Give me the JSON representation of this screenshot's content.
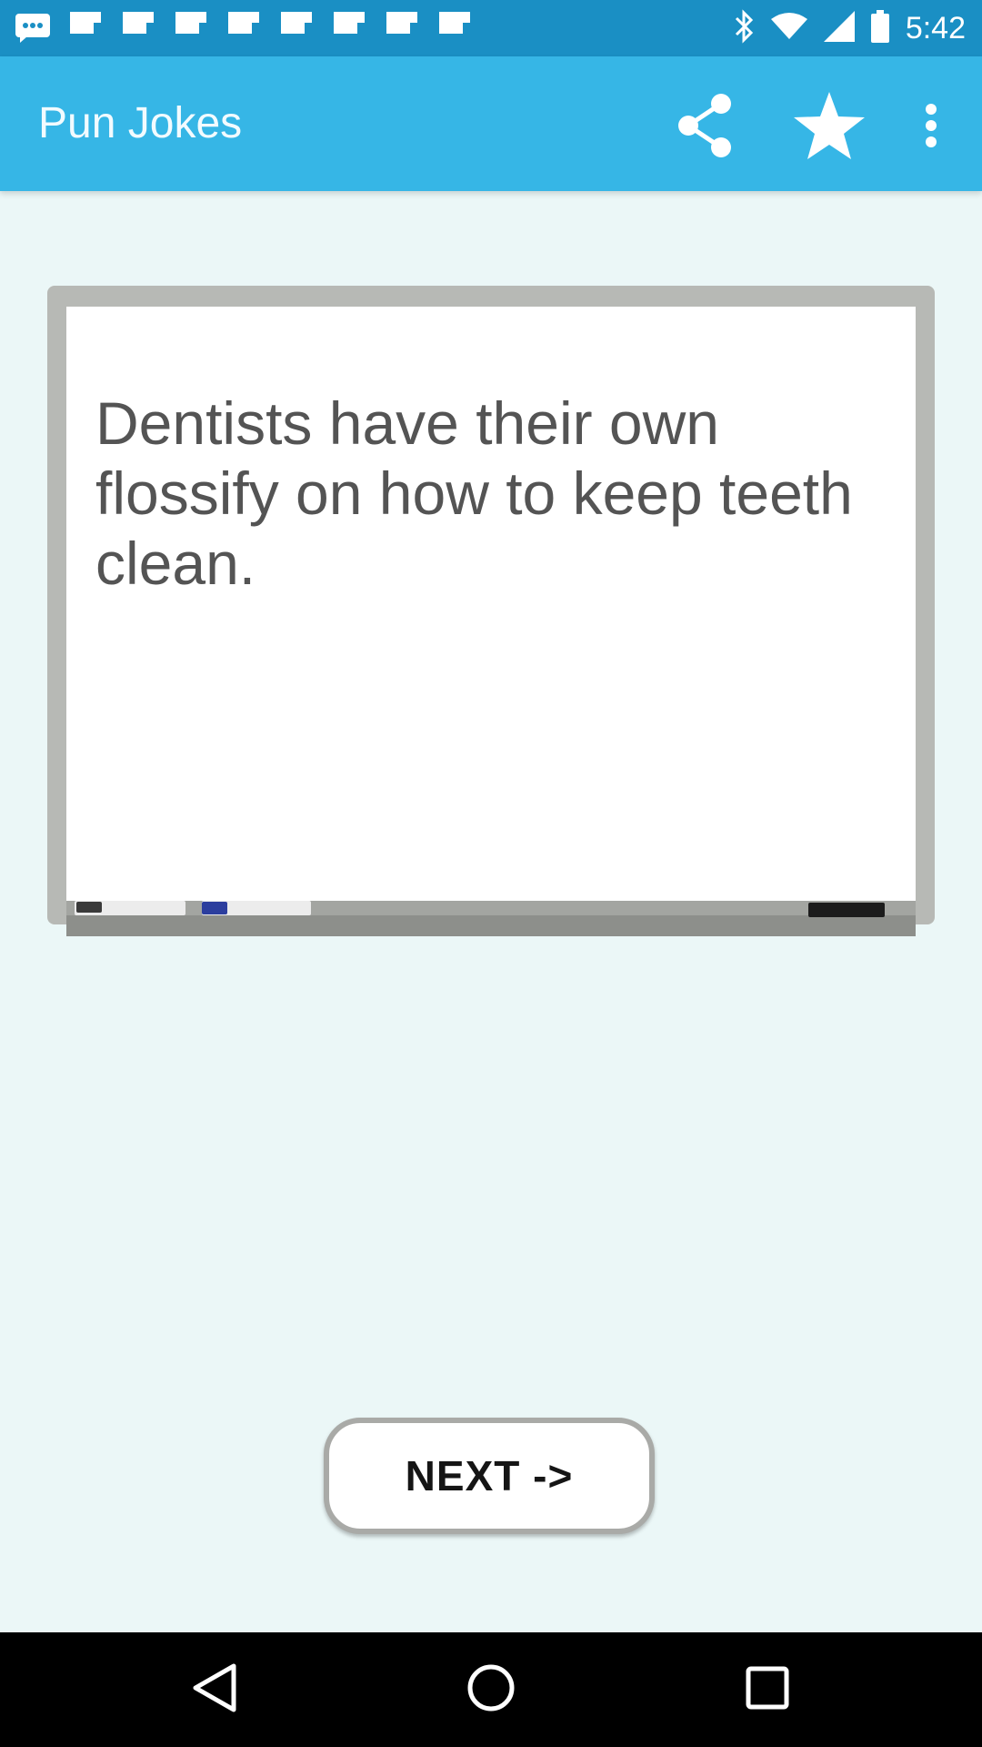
{
  "status_bar": {
    "time": "5:42",
    "icons": [
      "sms-icon",
      "flipboard-icon",
      "flipboard-icon",
      "flipboard-icon",
      "flipboard-icon",
      "flipboard-icon",
      "flipboard-icon",
      "flipboard-icon",
      "flipboard-icon",
      "bluetooth-icon",
      "wifi-icon",
      "signal-icon",
      "battery-icon"
    ]
  },
  "app_bar": {
    "title": "Pun Jokes",
    "color": "#36b6e6",
    "actions": [
      "share-icon",
      "star-icon",
      "more-vert-icon"
    ]
  },
  "joke": {
    "text": "Dentists have their own flossify on how to keep teeth clean."
  },
  "next_button": {
    "label": "NEXT ->"
  },
  "nav_bar": {
    "buttons": [
      "back-icon",
      "home-icon",
      "recents-icon"
    ]
  }
}
